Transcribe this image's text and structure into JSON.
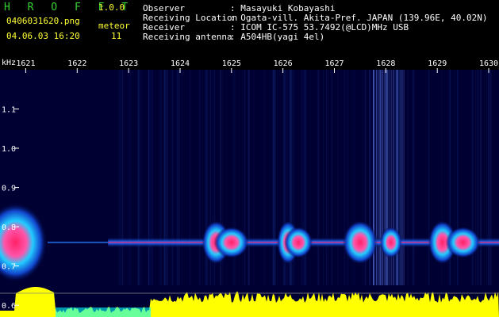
{
  "app": {
    "title": "H R O F F T",
    "version": "1.0.0"
  },
  "file": {
    "name": "0406031620.png",
    "datetime": "04.06.03 16:20"
  },
  "meteor": {
    "label": "meteor",
    "count": "11"
  },
  "info": [
    {
      "key": "Observer",
      "value": ": Masayuki Kobayashi"
    },
    {
      "key": "Receiving Location",
      "value": ": Ogata-vill. Akita-Pref. JAPAN (139.96E, 40.02N)"
    },
    {
      "key": "Receiver",
      "value": ": ICOM IC-575 53.7492(@LCD)MHz USB"
    },
    {
      "key": "Receiving antenna",
      "value": ": A504HB(yagi 4el)"
    }
  ],
  "colors": {
    "title": "#34d334",
    "accent": "#ffff33",
    "background": "#000000",
    "spectrogram_bg": "#000033",
    "signal_core": "#ff3377",
    "signal_edge": "#22bbff",
    "level": "#ffff00",
    "level_alt": "#00ffff"
  },
  "chart_data": {
    "type": "heatmap",
    "ylabel": "kHz",
    "x_ticks": [
      "1621",
      "1622",
      "1623",
      "1624",
      "1625",
      "1626",
      "1627",
      "1628",
      "1629",
      "1630"
    ],
    "y_ticks": [
      "1.1",
      "1.0",
      "0.9",
      "0.8",
      "0.7",
      "0.6"
    ],
    "xlim": [
      1620.5,
      1630.2
    ],
    "ylim": [
      0.57,
      1.2
    ],
    "signal_khz": 0.76,
    "meteor_pings_minute": [
      1620.8,
      1624.7,
      1625.0,
      1626.1,
      1626.3,
      1627.5,
      1628.1,
      1629.1,
      1629.5
    ]
  }
}
